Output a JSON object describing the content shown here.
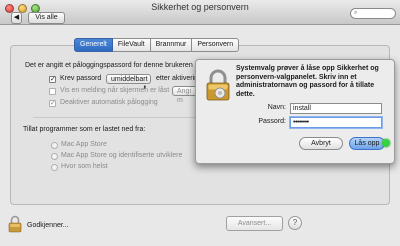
{
  "window": {
    "title": "Sikkerhet og personvern",
    "show_all": "Vis alle",
    "back_glyph": "◀",
    "forward_glyph": "▶"
  },
  "tabs": [
    {
      "label": "Generelt",
      "active": true
    },
    {
      "label": "FileVault",
      "active": false
    },
    {
      "label": "Brannmur",
      "active": false
    },
    {
      "label": "Personvern",
      "active": false
    }
  ],
  "general": {
    "intro": "Det er angitt et påloggingspassord for denne brukeren",
    "require_password_label": "Krev passord",
    "require_password_value": "umiddelbart",
    "require_password_suffix": "etter aktivering",
    "show_message_label": "Vis en melding når skjermen er låst",
    "set_message_button": "Angi m",
    "disable_autologin_label": "Deaktiver automatisk pålogging",
    "allow_apps_label": "Tillat programmer som er lastet ned fra:",
    "radio_options": [
      "Mac App Store",
      "Mac App Store og identifiserte utviklere",
      "Hvor som helst"
    ]
  },
  "bottom": {
    "authenticate_label": "Godkjenner...",
    "advanced_button": "Avansert...",
    "help_glyph": "?"
  },
  "dialog": {
    "message": "Systemvalg prøver å låse opp Sikkerhet og personvern-valgpanelet. Skriv inn et administratornavn og passord for å tillate dette.",
    "name_label": "Navn:",
    "name_value": "install",
    "password_label": "Passord:",
    "password_value": "••••••••",
    "cancel_button": "Avbryt",
    "unlock_button": "Lås opp"
  },
  "colors": {
    "accent": "#2f6bc2",
    "unlock_button": "#6da3ea",
    "indicator": "#35d33f"
  }
}
